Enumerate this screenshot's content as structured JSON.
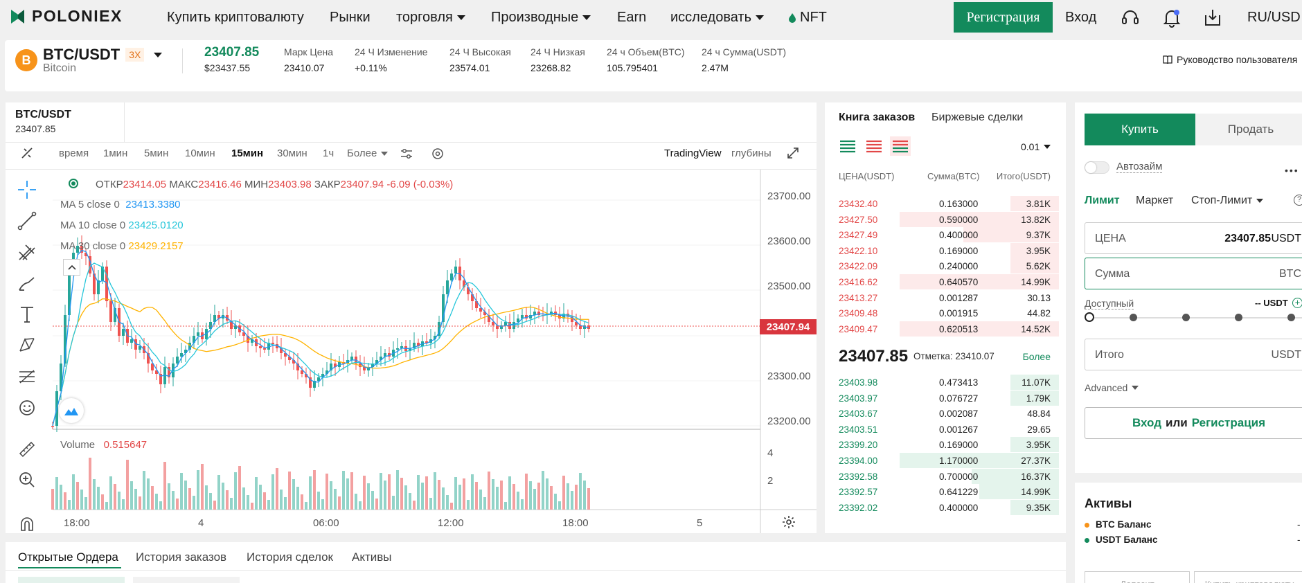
{
  "nav": {
    "brand": "POLONIEX",
    "items": [
      {
        "label": "Купить криптовалюту",
        "dropdown": false
      },
      {
        "label": "Рынки",
        "dropdown": false
      },
      {
        "label": "торговля",
        "dropdown": true
      },
      {
        "label": "Производные",
        "dropdown": true
      },
      {
        "label": "Earn",
        "dropdown": false
      },
      {
        "label": "исследовать",
        "dropdown": true
      },
      {
        "label": "NFT",
        "dropdown": false
      }
    ],
    "signup": "Регистрация",
    "login": "Вход",
    "currency": "RU/USD"
  },
  "ticker": {
    "pair": "BTC/USDT",
    "leverage": "3X",
    "name": "Bitcoin",
    "coin_icon": "B",
    "last_price": "23407.85",
    "last_price_usd": "$23437.55",
    "stats": [
      {
        "label": "Марк Цена",
        "value": "23410.07"
      },
      {
        "label": "24 Ч Изменение",
        "value": "+0.11%"
      },
      {
        "label": "24 Ч Высокая",
        "value": "23574.01"
      },
      {
        "label": "24 Ч Низкая",
        "value": "23268.82"
      },
      {
        "label": "24 ч Объем(BTC)",
        "value": "105.795401"
      },
      {
        "label": "24 ч Сумма(USDT)",
        "value": "2.47M"
      }
    ],
    "guide": "Руководство пользователя"
  },
  "chart": {
    "pair_tab": "BTC/USDT",
    "pair_price": "23407.85",
    "intervals": [
      "время",
      "1мин",
      "5мин",
      "10мин",
      "15мин",
      "30мин",
      "1ч"
    ],
    "active_interval": "15мин",
    "more": "Более",
    "view_tradingview": "TradingView",
    "view_depth": "глубины",
    "ohlc": {
      "open_label": "ОТКР",
      "open": "23414.05",
      "high_label": "МАКС",
      "high": "23416.46",
      "low_label": "МИН",
      "low": "23403.98",
      "close_label": "ЗАКР",
      "close": "23407.94",
      "change": "-6.09 (-0.03%)"
    },
    "ma": [
      {
        "label": "MA 5 close 0",
        "value": "23413.3380",
        "color": "#2196f3"
      },
      {
        "label": "MA 10 close 0",
        "value": "23425.0120",
        "color": "#26c6da"
      },
      {
        "label": "MA 30 close 0",
        "value": "23429.2157",
        "color": "#ffb300"
      }
    ],
    "price_ticks": [
      "23700.00",
      "23600.00",
      "23500.00",
      "23400.00",
      "23300.00",
      "23200.00"
    ],
    "last_price_tag": "23407.94",
    "volume_label": "Volume",
    "volume_value": "0.515647",
    "volume_ticks": [
      "4",
      "2"
    ],
    "time_ticks": [
      "18:00",
      "4",
      "06:00",
      "12:00",
      "18:00",
      "5"
    ]
  },
  "orderbook": {
    "tab_book": "Книга заказов",
    "tab_trades": "Биржевые сделки",
    "precision": "0.01",
    "col_price": "ЦЕНА(USDT)",
    "col_amount": "Сумма(BTC)",
    "col_total": "Итого(USDT)",
    "asks": [
      {
        "price": "23432.40",
        "amount": "0.163000",
        "total": "3.81K",
        "depth": 0.2
      },
      {
        "price": "23427.50",
        "amount": "0.590000",
        "total": "13.82K",
        "depth": 1.0
      },
      {
        "price": "23427.49",
        "amount": "0.400000",
        "total": "9.37K",
        "depth": 0.6
      },
      {
        "price": "23422.10",
        "amount": "0.169000",
        "total": "3.95K",
        "depth": 0.2
      },
      {
        "price": "23422.09",
        "amount": "0.240000",
        "total": "5.62K",
        "depth": 0.3
      },
      {
        "price": "23416.62",
        "amount": "0.640570",
        "total": "14.99K",
        "depth": 1.0
      },
      {
        "price": "23413.27",
        "amount": "0.001287",
        "total": "30.13",
        "depth": 0.0
      },
      {
        "price": "23409.48",
        "amount": "0.001915",
        "total": "44.82",
        "depth": 0.0
      },
      {
        "price": "23409.47",
        "amount": "0.620513",
        "total": "14.52K",
        "depth": 1.0
      }
    ],
    "mid_price": "23407.85",
    "mark_label": "Отметка: 23410.07",
    "more": "Более",
    "bids": [
      {
        "price": "23403.98",
        "amount": "0.473413",
        "total": "11.07K",
        "depth": 0.25
      },
      {
        "price": "23403.97",
        "amount": "0.076727",
        "total": "1.79K",
        "depth": 0.05
      },
      {
        "price": "23403.67",
        "amount": "0.002087",
        "total": "48.84",
        "depth": 0.0
      },
      {
        "price": "23403.51",
        "amount": "0.001267",
        "total": "29.65",
        "depth": 0.0
      },
      {
        "price": "23399.20",
        "amount": "0.169000",
        "total": "3.95K",
        "depth": 0.05
      },
      {
        "price": "23394.00",
        "amount": "1.170000",
        "total": "27.37K",
        "depth": 1.0
      },
      {
        "price": "23392.58",
        "amount": "0.700000",
        "total": "16.37K",
        "depth": 0.55
      },
      {
        "price": "23392.57",
        "amount": "0.641229",
        "total": "14.99K",
        "depth": 0.5
      },
      {
        "price": "23392.02",
        "amount": "0.400000",
        "total": "9.35K",
        "depth": 0.3
      }
    ]
  },
  "trade": {
    "buy": "Купить",
    "sell": "Продать",
    "autoloan": "Автозайм",
    "order_types": [
      "Лимит",
      "Маркет",
      "Стоп-Лимит"
    ],
    "price_label": "ЦЕНА",
    "price_value": "23407.85",
    "price_unit": "USDT",
    "amount_placeholder": "Сумма",
    "amount_unit": "BTC",
    "available_label": "Доступный",
    "available_value": "-- USDT",
    "total_label": "Итого",
    "total_unit": "USDT",
    "advanced": "Advanced",
    "login": "Вход",
    "or": "или",
    "register": "Регистрация"
  },
  "assets": {
    "title": "Активы",
    "items": [
      {
        "label": "BTC Баланс",
        "value": "-",
        "color": "#f7931a"
      },
      {
        "label": "USDT Баланс",
        "value": "-",
        "color": "#138a5c"
      }
    ],
    "deposit": "Депозит",
    "buy_crypto": "Купить криптовалюту"
  },
  "orders": {
    "tabs": [
      "Открытые Ордера",
      "История заказов",
      "История сделок",
      "Активы"
    ]
  },
  "colors": {
    "green": "#138a5c",
    "red": "#e24747",
    "up": "#26a69a",
    "down": "#ef5350"
  }
}
